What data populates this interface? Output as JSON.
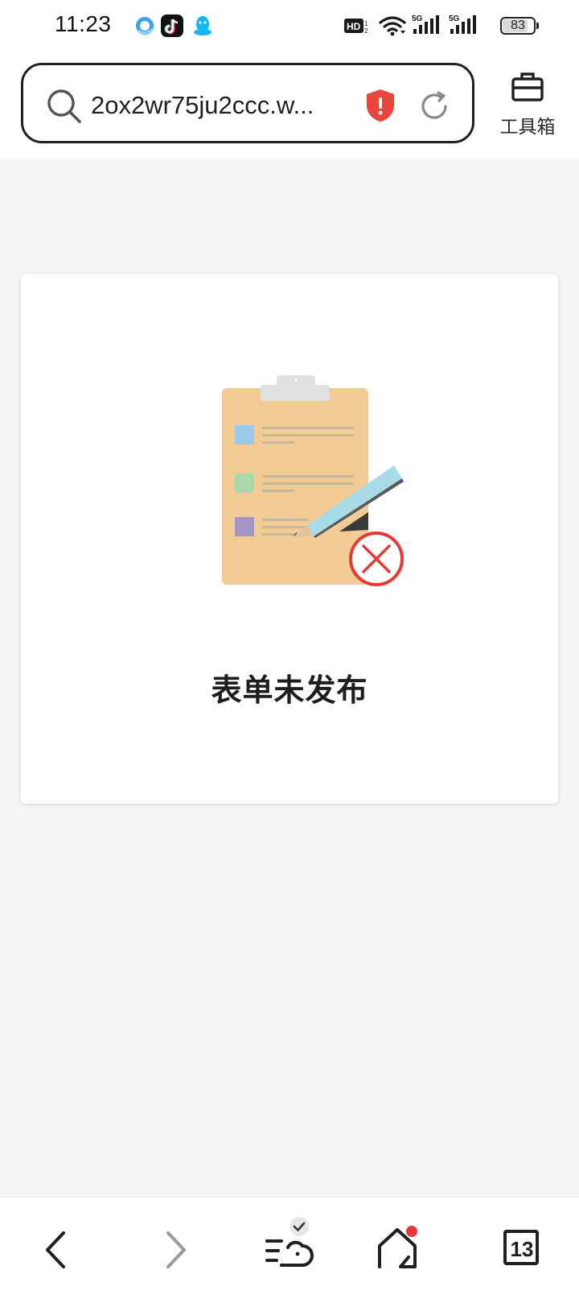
{
  "status_bar": {
    "time": "11:23",
    "apps": [
      "browser-app-icon",
      "tiktok-app-icon",
      "qq-app-icon"
    ],
    "indicators": {
      "hd": "HD",
      "hd_sub": "2",
      "network_1": "5G",
      "network_2": "5G"
    },
    "battery_level": "83",
    "battery_fraction": 0.83
  },
  "address_bar": {
    "url": "2ox2wr75ju2ccc.w...",
    "security_icon": "shield-warning-icon",
    "refresh_icon": "refresh-icon",
    "search_icon": "search-icon"
  },
  "toolbox": {
    "label": "工具箱",
    "icon": "toolbox-icon"
  },
  "card": {
    "message": "表单未发布",
    "illustration": "clipboard-error-illustration"
  },
  "bottom_nav": {
    "tab_count": "13",
    "items": [
      "back-icon",
      "forward-icon",
      "reading-mode-icon",
      "home-icon",
      "tabs-icon"
    ]
  },
  "colors": {
    "accent_red": "#e8453c",
    "clipboard": "#f2cb95",
    "clip": "#e0e0e0",
    "pencil": "#a9dae8",
    "badge_red": "#e53935"
  }
}
